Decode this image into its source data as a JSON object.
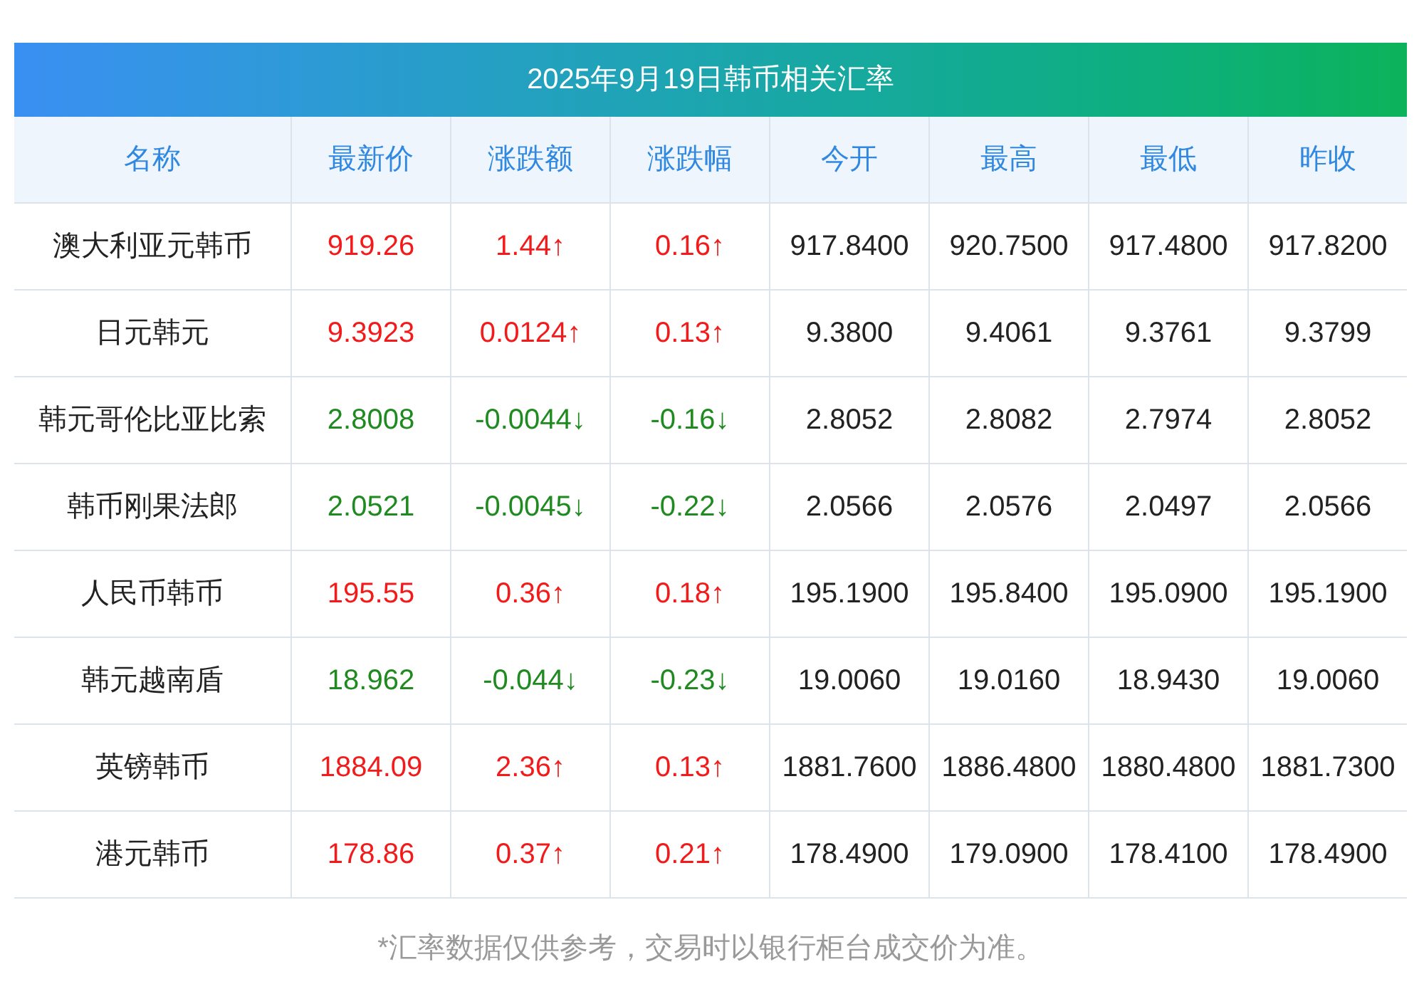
{
  "title": "2025年9月19日韩币相关汇率",
  "columns": [
    "名称",
    "最新价",
    "涨跌额",
    "涨跌幅",
    "今开",
    "最高",
    "最低",
    "昨收"
  ],
  "rows": [
    {
      "kind": "up",
      "cells": [
        "澳大利亚元韩币",
        "919.26",
        "1.44↑",
        "0.16↑",
        "917.8400",
        "920.7500",
        "917.4800",
        "917.8200"
      ]
    },
    {
      "kind": "up",
      "cells": [
        "日元韩元",
        "9.3923",
        "0.0124↑",
        "0.13↑",
        "9.3800",
        "9.4061",
        "9.3761",
        "9.3799"
      ]
    },
    {
      "kind": "down",
      "cells": [
        "韩元哥伦比亚比索",
        "2.8008",
        "-0.0044↓",
        "-0.16↓",
        "2.8052",
        "2.8082",
        "2.7974",
        "2.8052"
      ]
    },
    {
      "kind": "down",
      "cells": [
        "韩币刚果法郎",
        "2.0521",
        "-0.0045↓",
        "-0.22↓",
        "2.0566",
        "2.0576",
        "2.0497",
        "2.0566"
      ]
    },
    {
      "kind": "up",
      "cells": [
        "人民币韩币",
        "195.55",
        "0.36↑",
        "0.18↑",
        "195.1900",
        "195.8400",
        "195.0900",
        "195.1900"
      ]
    },
    {
      "kind": "down",
      "cells": [
        "韩元越南盾",
        "18.962",
        "-0.044↓",
        "-0.23↓",
        "19.0060",
        "19.0160",
        "18.9430",
        "19.0060"
      ]
    },
    {
      "kind": "up",
      "cells": [
        "英镑韩币",
        "1884.09",
        "2.36↑",
        "0.13↑",
        "1881.7600",
        "1886.4800",
        "1880.4800",
        "1881.7300"
      ]
    },
    {
      "kind": "up",
      "cells": [
        "港元韩币",
        "178.86",
        "0.37↑",
        "0.21↑",
        "178.4900",
        "179.0900",
        "178.4100",
        "178.4900"
      ]
    }
  ],
  "footnote": "*汇率数据仅供参考，交易时以银行柜台成交价为准。"
}
